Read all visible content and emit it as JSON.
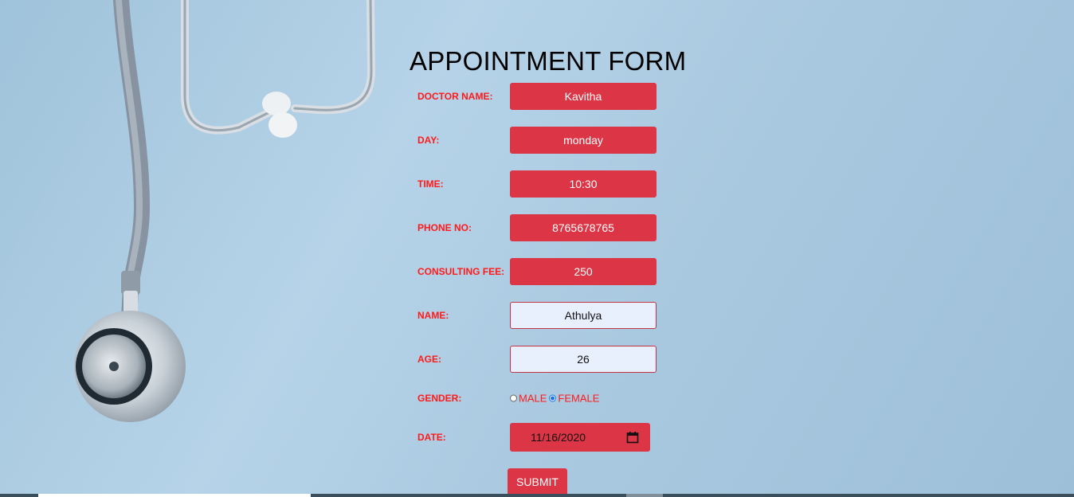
{
  "form": {
    "title": "APPOINTMENT FORM",
    "doctor_name": {
      "label": "DOCTOR NAME:",
      "value": "Kavitha"
    },
    "day": {
      "label": "DAY:",
      "value": "monday"
    },
    "time": {
      "label": "TIME:",
      "value": "10:30"
    },
    "phone": {
      "label": "PHONE NO:",
      "value": "8765678765"
    },
    "fee": {
      "label": "CONSULTING FEE:",
      "value": "250"
    },
    "name": {
      "label": "NAME:",
      "value": "Athulya"
    },
    "age": {
      "label": "AGE:",
      "value": "26"
    },
    "gender": {
      "label": "GENDER:",
      "options": [
        "MALE",
        "FEMALE"
      ],
      "selected": "FEMALE"
    },
    "date": {
      "label": "DATE:",
      "value": "11/16/2020"
    },
    "submit_label": "SUBMIT"
  },
  "background": {
    "image": "stethoscope-image"
  },
  "colors": {
    "accent": "#dc3545",
    "label": "#ff1a1a",
    "input_bg": "#e8f0fe"
  }
}
